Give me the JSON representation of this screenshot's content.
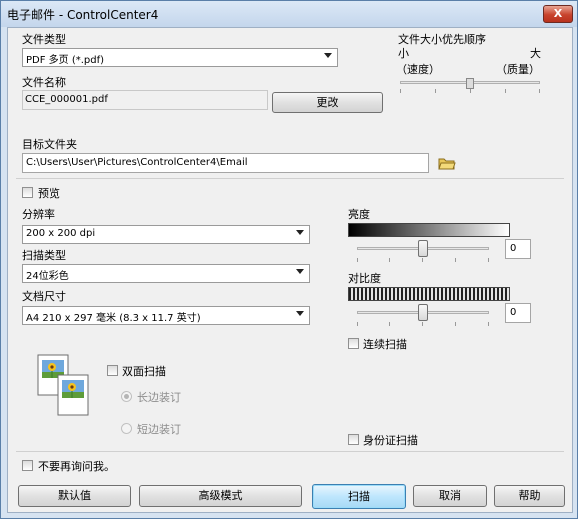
{
  "window": {
    "title": "电子邮件 - ControlCenter4",
    "close_glyph": "X"
  },
  "file_type": {
    "label": "文件类型",
    "value": "PDF 多页 (*.pdf)"
  },
  "file_name": {
    "label": "文件名称",
    "value": "CCE_000001.pdf",
    "change_button": "更改"
  },
  "priority": {
    "label": "文件大小优先顺序",
    "small": "小",
    "large": "大",
    "speed": "（速度）",
    "quality": "（质量）",
    "level": 0.5
  },
  "target_folder": {
    "label": "目标文件夹",
    "path": "C:\\Users\\User\\Pictures\\ControlCenter4\\Email"
  },
  "preview": {
    "label": "预览",
    "checked": false
  },
  "resolution": {
    "label": "分辨率",
    "value": "200 x 200 dpi"
  },
  "scan_type": {
    "label": "扫描类型",
    "value": "24位彩色"
  },
  "doc_size": {
    "label": "文档尺寸",
    "value": "A4 210 x 297 毫米 (8.3 x 11.7 英寸)"
  },
  "brightness": {
    "label": "亮度",
    "value": "0",
    "level": 0.5
  },
  "contrast": {
    "label": "对比度",
    "value": "0",
    "level": 0.5
  },
  "continuous_scan": {
    "label": "连续扫描",
    "checked": false
  },
  "duplex": {
    "label": "双面扫描",
    "checked": false,
    "long_edge": "长边装订",
    "short_edge": "短边装订",
    "selected": "long_edge"
  },
  "id_card": {
    "label": "身份证扫描",
    "checked": false
  },
  "dont_ask": {
    "label": "不要再询问我。",
    "checked": false
  },
  "buttons": {
    "default": "默认值",
    "advanced": "高级模式",
    "scan": "扫描",
    "cancel": "取消",
    "help": "帮助"
  }
}
